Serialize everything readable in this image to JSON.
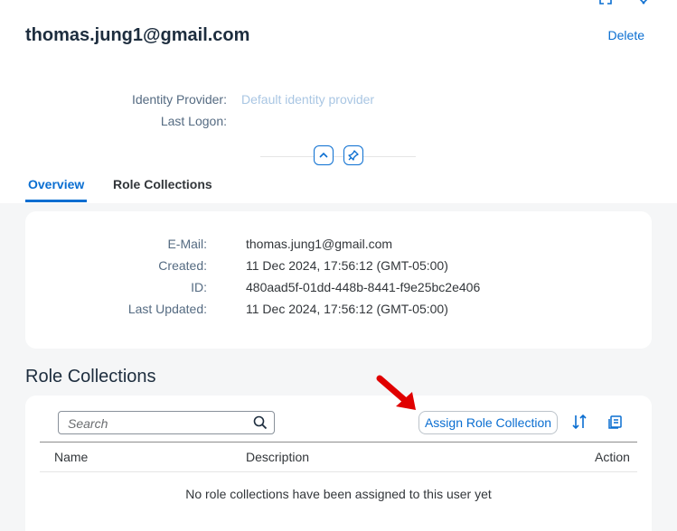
{
  "header": {
    "title": "thomas.jung1@gmail.com",
    "delete_label": "Delete",
    "fields": [
      {
        "label": "Identity Provider:",
        "value": "Default identity provider"
      },
      {
        "label": "Last Logon:",
        "value": ""
      }
    ]
  },
  "tabs": [
    {
      "label": "Overview",
      "active": true
    },
    {
      "label": "Role Collections",
      "active": false
    }
  ],
  "overview": {
    "rows": [
      {
        "label": "E-Mail:",
        "value": "thomas.jung1@gmail.com"
      },
      {
        "label": "Created:",
        "value": "11 Dec 2024, 17:56:12 (GMT-05:00)"
      },
      {
        "label": "ID:",
        "value": "480aad5f-01dd-448b-8441-f9e25bc2e406"
      },
      {
        "label": "Last Updated:",
        "value": "11 Dec 2024, 17:56:12 (GMT-05:00)"
      }
    ]
  },
  "role_collections": {
    "title": "Role Collections",
    "search_placeholder": "Search",
    "assign_label": "Assign Role Collection",
    "columns": [
      "Name",
      "Description",
      "Action"
    ],
    "empty_text": "No role collections have been assigned to this user yet"
  },
  "colors": {
    "accent": "#0a6ed1",
    "annotation_arrow": "#e00000"
  }
}
